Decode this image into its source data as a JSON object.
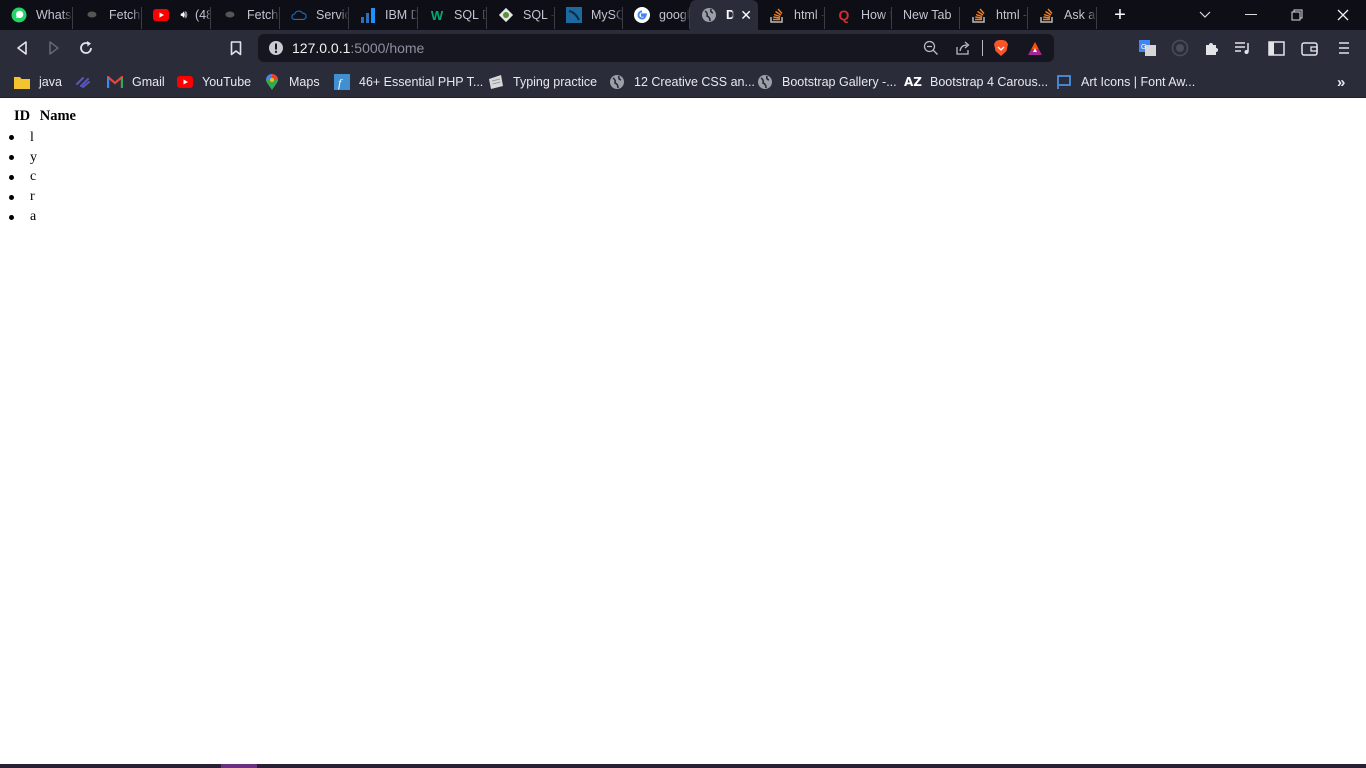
{
  "browser": {
    "tabs": [
      {
        "title": "WhatsApp",
        "icon": "whatsapp-icon",
        "active": false
      },
      {
        "title": "Fetching",
        "icon": "bee-icon",
        "active": false
      },
      {
        "title": "(48",
        "icon": "youtube-icon",
        "audio": true,
        "active": false
      },
      {
        "title": "Fetching",
        "icon": "bee-icon",
        "active": false
      },
      {
        "title": "Service",
        "icon": "cloud-icon",
        "active": false
      },
      {
        "title": "IBM D",
        "icon": "bar-chart-icon",
        "active": false
      },
      {
        "title": "SQL D",
        "icon": "w3schools-icon",
        "active": false
      },
      {
        "title": "SQL -",
        "icon": "sql-icon",
        "active": false
      },
      {
        "title": "MySQL",
        "icon": "mysql-icon",
        "active": false
      },
      {
        "title": "google",
        "icon": "google-icon",
        "active": false
      },
      {
        "title": "Do",
        "icon": "globe-icon",
        "active": true
      },
      {
        "title": "html -",
        "icon": "stackoverflow-icon",
        "active": false
      },
      {
        "title": "How t",
        "icon": "quora-icon",
        "active": false
      },
      {
        "title": "New Tab",
        "icon": "",
        "active": false
      },
      {
        "title": "html -",
        "icon": "stackoverflow-icon",
        "active": false
      },
      {
        "title": "Ask a",
        "icon": "stackoverflow-icon",
        "active": false
      }
    ],
    "new_tab_label": "+",
    "address": {
      "host": "127.0.0.1",
      "rest": ":5000/home"
    },
    "bookmarks": [
      {
        "label": "java",
        "icon": "folder-icon"
      },
      {
        "label": "",
        "icon": "link-icon"
      },
      {
        "label": "Gmail",
        "icon": "gmail-icon"
      },
      {
        "label": "YouTube",
        "icon": "youtube-icon"
      },
      {
        "label": "Maps",
        "icon": "maps-icon"
      },
      {
        "label": "46+ Essential PHP T...",
        "icon": "f-icon"
      },
      {
        "label": "Typing practice",
        "icon": "keyboard-icon"
      },
      {
        "label": "12 Creative CSS an...",
        "icon": "globe-icon"
      },
      {
        "label": "Bootstrap Gallery -...",
        "icon": "globe-icon"
      },
      {
        "label": "Bootstrap 4 Carous...",
        "icon": "az-icon"
      },
      {
        "label": "Art Icons | Font Aw...",
        "icon": "flag-icon"
      }
    ],
    "bookmarks_overflow": "»"
  },
  "page": {
    "headers": {
      "id": "ID",
      "name": "Name"
    },
    "items": [
      "l",
      "y",
      "c",
      "r",
      "a"
    ]
  }
}
